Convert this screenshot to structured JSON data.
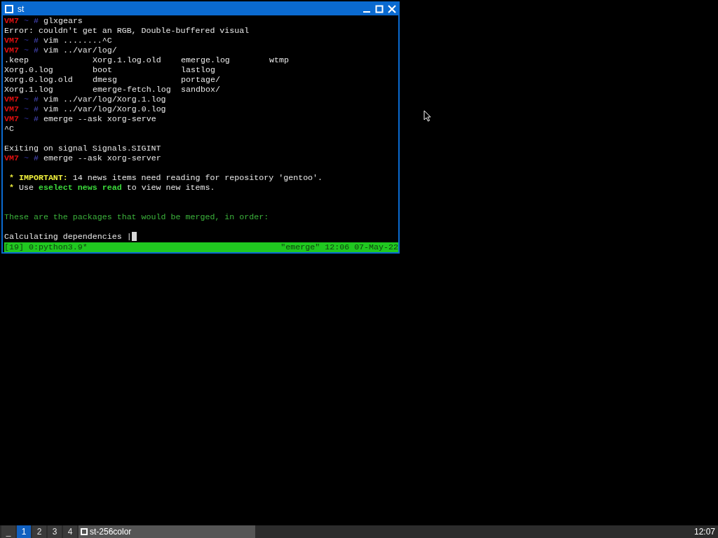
{
  "window": {
    "title": "st"
  },
  "terminal": {
    "lines": [
      {
        "kind": "prompt",
        "host": "VM7",
        "dir": "~",
        "sign": "#",
        "command": "glxgears"
      },
      {
        "kind": "output",
        "segments": [
          {
            "kind": "text",
            "text": "Error: couldn't get an RGB, Double-buffered visual"
          }
        ]
      },
      {
        "kind": "prompt",
        "host": "VM7",
        "dir": "~",
        "sign": "#",
        "command": "vim ........^C"
      },
      {
        "kind": "prompt",
        "host": "VM7",
        "dir": "~",
        "sign": "#",
        "command": "vim ../var/log/"
      },
      {
        "kind": "columns",
        "cells": [
          ".keep",
          "Xorg.1.log.old",
          "emerge.log",
          "wtmp"
        ]
      },
      {
        "kind": "columns",
        "cells": [
          "Xorg.0.log",
          "boot",
          "lastlog"
        ]
      },
      {
        "kind": "columns",
        "cells": [
          "Xorg.0.log.old",
          "dmesg",
          "portage/"
        ]
      },
      {
        "kind": "columns",
        "cells": [
          "Xorg.1.log",
          "emerge-fetch.log",
          "sandbox/"
        ]
      },
      {
        "kind": "prompt",
        "host": "VM7",
        "dir": "~",
        "sign": "#",
        "command": "vim ../var/log/Xorg.1.log"
      },
      {
        "kind": "prompt",
        "host": "VM7",
        "dir": "~",
        "sign": "#",
        "command": "vim ../var/log/Xorg.0.log"
      },
      {
        "kind": "prompt",
        "host": "VM7",
        "dir": "~",
        "sign": "#",
        "command": "emerge --ask xorg-serve"
      },
      {
        "kind": "output",
        "segments": [
          {
            "kind": "text",
            "text": "^C"
          }
        ]
      },
      {
        "kind": "blank"
      },
      {
        "kind": "output",
        "segments": [
          {
            "kind": "text",
            "text": "Exiting on signal Signals.SIGINT"
          }
        ]
      },
      {
        "kind": "prompt",
        "host": "VM7",
        "dir": "~",
        "sign": "#",
        "command": "emerge --ask xorg-server"
      },
      {
        "kind": "blank"
      },
      {
        "kind": "output",
        "segments": [
          {
            "kind": "star",
            "text": " * "
          },
          {
            "kind": "warn",
            "text": "IMPORTANT:"
          },
          {
            "kind": "text",
            "text": " 14 news items need reading for repository 'gentoo'."
          }
        ]
      },
      {
        "kind": "output",
        "segments": [
          {
            "kind": "star",
            "text": " * "
          },
          {
            "kind": "text",
            "text": "Use "
          },
          {
            "kind": "good",
            "text": "eselect news read"
          },
          {
            "kind": "text",
            "text": " to view new items."
          }
        ]
      },
      {
        "kind": "blank"
      },
      {
        "kind": "blank"
      },
      {
        "kind": "output",
        "segments": [
          {
            "kind": "info",
            "text": "These are the packages that would be merged, in order:"
          }
        ]
      },
      {
        "kind": "blank"
      },
      {
        "kind": "output",
        "cursor": true,
        "segments": [
          {
            "kind": "text",
            "text": "Calculating dependencies |"
          }
        ]
      }
    ]
  },
  "status_bar": {
    "left": "[19] 0:python3.9*",
    "right": "\"emerge\" 12:06 07-May-22"
  },
  "taskbar": {
    "desktops": [
      {
        "label": "_",
        "selected": false
      },
      {
        "label": "1",
        "selected": true
      },
      {
        "label": "2",
        "selected": false
      },
      {
        "label": "3",
        "selected": false
      },
      {
        "label": "4",
        "selected": false
      }
    ],
    "tasks": [
      {
        "label": "st-256color"
      }
    ],
    "clock": "12:07"
  }
}
